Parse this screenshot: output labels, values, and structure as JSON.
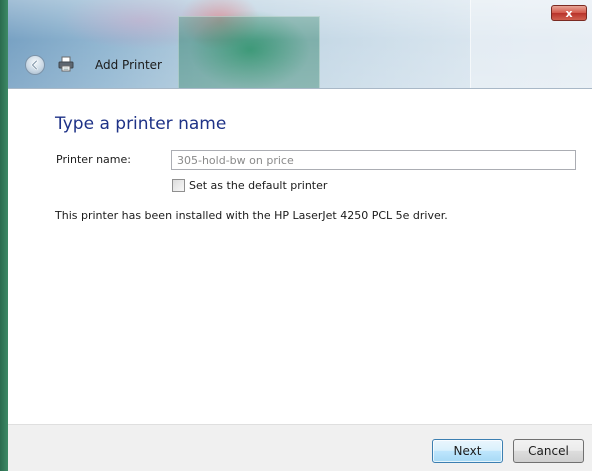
{
  "window": {
    "title": "Add Printer",
    "close_glyph": "x"
  },
  "page": {
    "heading": "Type a printer name",
    "printer_name_label": "Printer name:",
    "printer_name_value": "305-hold-bw on price",
    "default_checkbox_label": "Set as the default printer",
    "default_checkbox_checked": false,
    "info_text": "This printer has been installed with the HP LaserJet 4250 PCL 5e driver."
  },
  "footer": {
    "next_label": "Next",
    "cancel_label": "Cancel"
  },
  "icons": {
    "back": "back-arrow-icon",
    "printer": "printer-icon",
    "close": "close-icon"
  },
  "colors": {
    "heading": "#1e3287",
    "close_button": "#c94a3d",
    "next_button_border": "#3c7fb1"
  }
}
